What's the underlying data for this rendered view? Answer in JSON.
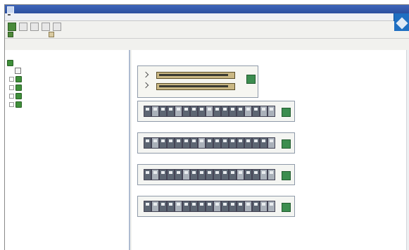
{
  "window": {
    "title": "",
    "accent_color": "#2d57ad"
  },
  "menubar": {
    "items": [
      "",
      "",
      "",
      "",
      "",
      "",
      "",
      "",
      "",
      "",
      ""
    ]
  },
  "toolbar2": {
    "items": [
      {
        "label": ""
      },
      {
        "label": ""
      }
    ]
  },
  "left_pane": {
    "header": "",
    "tree": [
      {
        "label": "",
        "icon": "green-node-icon"
      },
      {
        "label": "",
        "icon": "server-icon"
      },
      {
        "label": "",
        "icon": "green-node-icon"
      },
      {
        "label": "",
        "icon": "green-node-icon"
      },
      {
        "label": "",
        "icon": "green-node-icon"
      },
      {
        "label": "",
        "icon": "green-node-icon"
      }
    ]
  },
  "right_pane": {
    "header": "",
    "controller": {
      "title": "",
      "rows": [
        "",
        ""
      ]
    },
    "enclosures": [
      {
        "title": ""
      },
      {
        "title": ""
      },
      {
        "title": ""
      },
      {
        "title": ""
      }
    ]
  }
}
